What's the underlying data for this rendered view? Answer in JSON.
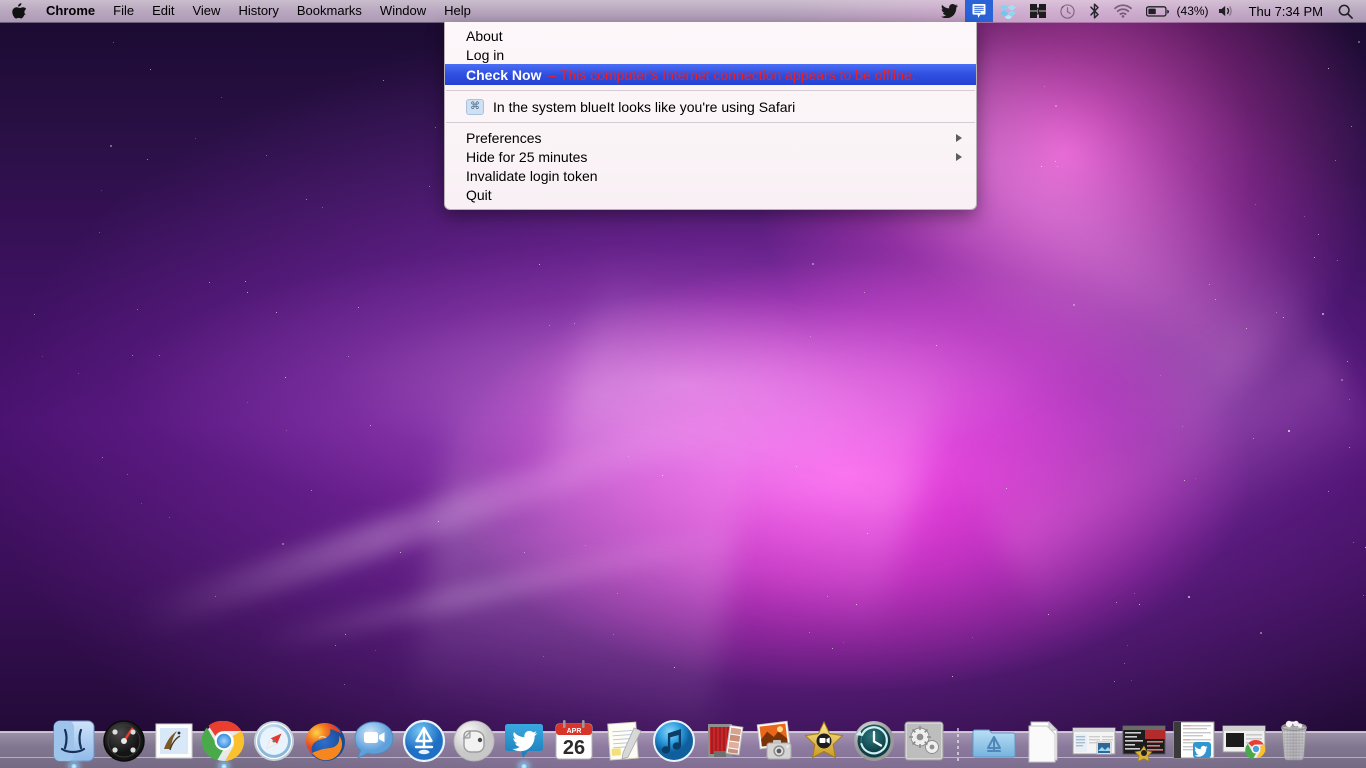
{
  "menubar": {
    "apple_icon": "apple-logo-icon",
    "items": [
      {
        "label": "Chrome",
        "bold": true
      },
      {
        "label": "File",
        "bold": false
      },
      {
        "label": "Edit",
        "bold": false
      },
      {
        "label": "View",
        "bold": false
      },
      {
        "label": "History",
        "bold": false
      },
      {
        "label": "Bookmarks",
        "bold": false
      },
      {
        "label": "Window",
        "bold": false
      },
      {
        "label": "Help",
        "bold": false
      }
    ],
    "extras": [
      {
        "name": "twitter-bird-icon",
        "active": false
      },
      {
        "name": "messages-bubble-icon",
        "active": true
      },
      {
        "name": "dropbox-icon",
        "active": false
      },
      {
        "name": "flux-icon",
        "active": false
      },
      {
        "name": "time-machine-icon",
        "active": false
      },
      {
        "name": "bluetooth-icon",
        "active": false
      },
      {
        "name": "wifi-icon",
        "active": false
      },
      {
        "name": "battery-icon",
        "active": false
      }
    ],
    "battery_percent": "(43%)",
    "volume_icon": "volume-icon",
    "clock": "Thu 7:34 PM",
    "spotlight_icon": "search-icon"
  },
  "menu": {
    "sections": [
      {
        "rows": [
          {
            "label": "About",
            "selected": false,
            "arrow": false,
            "icon": null,
            "error": null
          },
          {
            "label": "Log in",
            "selected": false,
            "arrow": false,
            "icon": null,
            "error": null
          },
          {
            "label": "Check Now",
            "selected": true,
            "arrow": false,
            "icon": null,
            "error": "– This computer's Internet connection appears to be offline."
          }
        ]
      },
      {
        "rows": [
          {
            "label": "In the system blueIt looks like you're using Safari",
            "selected": false,
            "arrow": false,
            "icon": "command-key-icon",
            "icon_glyph": "⌘",
            "error": null
          }
        ]
      },
      {
        "rows": [
          {
            "label": "Preferences",
            "selected": false,
            "arrow": true,
            "icon": null,
            "error": null
          },
          {
            "label": "Hide for 25 minutes",
            "selected": false,
            "arrow": true,
            "icon": null,
            "error": null
          },
          {
            "label": "Invalidate login token",
            "selected": false,
            "arrow": false,
            "icon": null,
            "error": null
          },
          {
            "label": "Quit",
            "selected": false,
            "arrow": false,
            "icon": null,
            "error": null
          }
        ]
      }
    ]
  },
  "dock": {
    "apps": [
      {
        "name": "finder",
        "label": "Finder",
        "running": true
      },
      {
        "name": "dashboard",
        "label": "Dashboard",
        "running": false
      },
      {
        "name": "mail",
        "label": "Mail",
        "running": false
      },
      {
        "name": "chrome",
        "label": "Google Chrome",
        "running": true
      },
      {
        "name": "safari",
        "label": "Safari",
        "running": false
      },
      {
        "name": "firefox",
        "label": "Firefox",
        "running": false
      },
      {
        "name": "facetime",
        "label": "FaceTime",
        "running": false
      },
      {
        "name": "app-store",
        "label": "App Store",
        "running": false
      },
      {
        "name": "evernote",
        "label": "Evernote",
        "running": false
      },
      {
        "name": "twitter",
        "label": "Twitter",
        "running": true
      },
      {
        "name": "calendar",
        "label": "Calendar",
        "running": false,
        "month": "APR",
        "day": "26"
      },
      {
        "name": "notes",
        "label": "Notes",
        "running": false
      },
      {
        "name": "itunes",
        "label": "iTunes",
        "running": false
      },
      {
        "name": "photo-booth",
        "label": "Photo Booth",
        "running": false
      },
      {
        "name": "iphoto",
        "label": "iPhoto",
        "running": false
      },
      {
        "name": "imovie",
        "label": "iMovie",
        "running": false
      },
      {
        "name": "time-machine",
        "label": "Time Machine",
        "running": false
      },
      {
        "name": "system-preferences",
        "label": "System Preferences",
        "running": false
      }
    ],
    "docs": [
      {
        "name": "applications-folder",
        "label": "Applications"
      },
      {
        "name": "documents-stack",
        "label": "Documents"
      },
      {
        "name": "minimized-window-finder",
        "label": "Finder Window"
      },
      {
        "name": "minimized-window-terminal",
        "label": "Terminal Window"
      },
      {
        "name": "minimized-window-twitter",
        "label": "Twitter Window"
      },
      {
        "name": "minimized-window-chrome",
        "label": "Chrome Window"
      },
      {
        "name": "trash",
        "label": "Trash"
      }
    ]
  }
}
